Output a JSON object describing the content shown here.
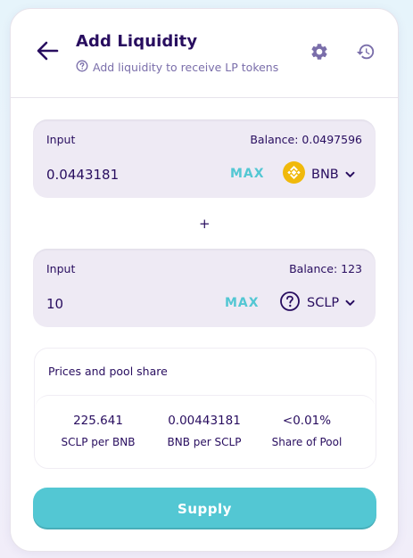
{
  "header": {
    "title": "Add Liquidity",
    "subtitle": "Add liquidity to receive LP tokens",
    "back_icon": "arrow-left-icon",
    "settings_icon": "gear-icon",
    "history_icon": "history-icon"
  },
  "input_a": {
    "label": "Input",
    "balance": "Balance: 0.0497596",
    "value": "0.0443181",
    "max_label": "MAX",
    "currency": "BNB",
    "currency_icon": "bnb-logo-icon"
  },
  "plus": "+",
  "input_b": {
    "label": "Input",
    "balance": "Balance: 123",
    "value": "10",
    "max_label": "MAX",
    "currency": "SCLP",
    "currency_icon": "unknown-token-icon"
  },
  "prices": {
    "title": "Prices and pool share",
    "stats": [
      {
        "value": "225.641",
        "label": "SCLP per BNB"
      },
      {
        "value": "0.00443181",
        "label": "BNB per SCLP"
      },
      {
        "value": "<0.01%",
        "label": "Share of Pool"
      }
    ]
  },
  "supply_label": "Supply",
  "colors": {
    "accent": "#53c7d3",
    "text_primary": "#280d5f",
    "text_secondary": "#7a6eaa",
    "input_bg": "#eeeaf4",
    "bnb_yellow": "#f0b90b"
  }
}
